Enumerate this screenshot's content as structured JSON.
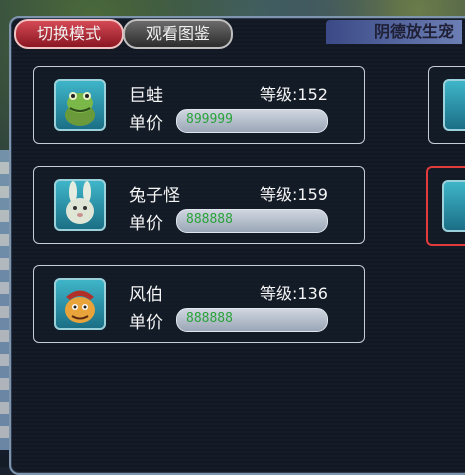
{
  "tabs": {
    "switch_mode": "切换模式",
    "view_catalog": "观看图鉴"
  },
  "window_title": "阴德放生宠",
  "level_prefix": "等级:",
  "price_label": "单价",
  "pets": [
    {
      "name": "巨蛙",
      "level": "152",
      "price": "899999",
      "icon": "giant-frog-icon"
    },
    {
      "name": "兔子怪",
      "level": "159",
      "price": "888888",
      "icon": "rabbit-monster-icon"
    },
    {
      "name": "风伯",
      "level": "136",
      "price": "888888",
      "icon": "wind-uncle-icon"
    }
  ],
  "colors": {
    "active_tab": "#d44a55",
    "price_text": "#2aa23a",
    "selected_border": "#e23b3b"
  }
}
